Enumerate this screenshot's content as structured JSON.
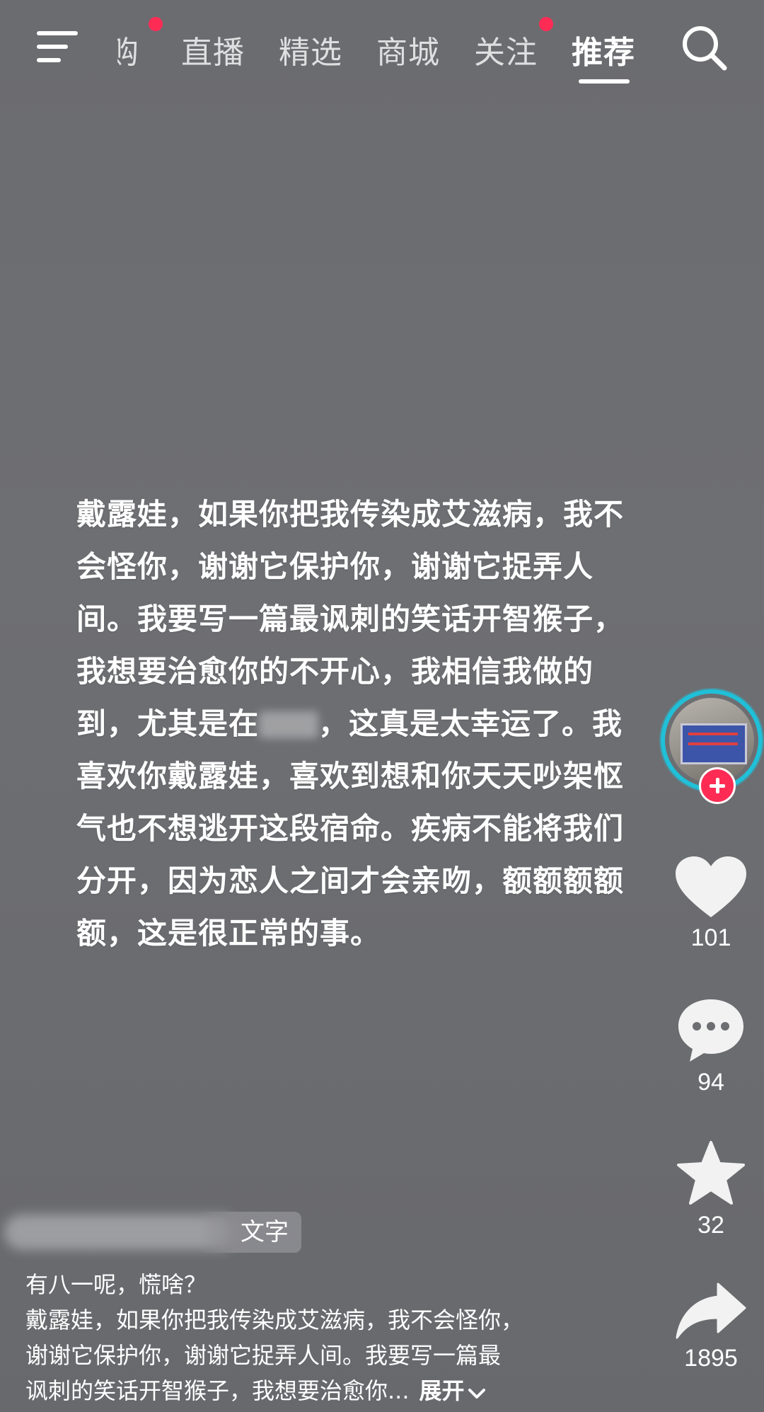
{
  "nav": {
    "tabs": [
      {
        "label": "购",
        "active": false,
        "dot": true
      },
      {
        "label": "直播",
        "active": false,
        "dot": false
      },
      {
        "label": "精选",
        "active": false,
        "dot": false
      },
      {
        "label": "商城",
        "active": false,
        "dot": false
      },
      {
        "label": "关注",
        "active": false,
        "dot": true
      },
      {
        "label": "推荐",
        "active": true,
        "dot": false
      }
    ],
    "menu_icon": "hamburger-menu-icon",
    "search_icon": "search-icon"
  },
  "post": {
    "lines": [
      "戴露娃，如果你把我传染成艾滋病，我不",
      "会怪你，谢谢它保护你，谢谢它捉弄人",
      "间。我要写一篇最讽刺的笑话开智猴子，",
      "我想要治愈你的不开心，我相信我做的",
      "到，尤其是在",
      "，这真是太幸运了。我",
      "喜欢你戴露娃，喜欢到想和你天天吵架怄",
      "气也不想逃开这段宿命。疾病不能将我们",
      "分开，因为恋人之间才会亲吻，额额额额",
      "额，这是很正常的事。"
    ]
  },
  "rail": {
    "likes": "101",
    "comments": "94",
    "favorites": "32",
    "shares": "1895",
    "icons": [
      "heart-icon",
      "comment-icon",
      "star-icon",
      "share-icon"
    ]
  },
  "info": {
    "tag": "文字",
    "caption_title": "有八一呢，慌啥？",
    "caption_lines": [
      "戴露娃，如果你把我传染成艾滋病，我不会怪你，",
      "谢谢它保护你，谢谢它捉弄人间。我要写一篇最",
      "讽刺的笑话开智猴子，我想要治愈你..."
    ],
    "expand_label": "展开"
  },
  "colors": {
    "accent_red": "#fe2c55",
    "ring_cyan": "#20c0d8",
    "background": "#6d6e72"
  }
}
